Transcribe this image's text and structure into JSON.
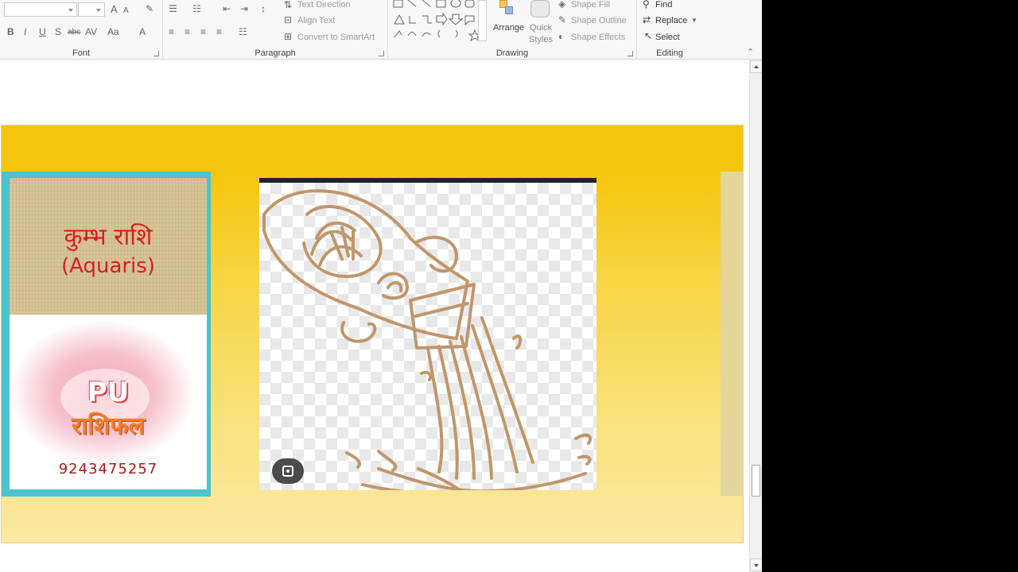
{
  "ribbon": {
    "font": {
      "label": "Font",
      "bold": "B",
      "italic": "I",
      "underline": "U",
      "strike": "S",
      "charspacing": "abc",
      "case": "Aa",
      "fontcolor": "A",
      "grow": "A",
      "shrink": "A"
    },
    "paragraph": {
      "label": "Paragraph",
      "text_direction": "Text Direction",
      "align_text": "Align Text",
      "convert_smartart": "Convert to SmartArt"
    },
    "drawing": {
      "label": "Drawing",
      "arrange": "Arrange",
      "quick_styles_1": "Quick",
      "quick_styles_2": "Styles",
      "shape_fill": "Shape Fill",
      "shape_outline": "Shape Outline",
      "shape_effects": "Shape Effects"
    },
    "editing": {
      "label": "Editing",
      "find": "Find",
      "replace": "Replace",
      "select": "Select"
    }
  },
  "slide": {
    "card": {
      "title_hindi": "कुम्भ राशि",
      "title_english": "(Aquaris)",
      "logo_pu": "PU",
      "logo_rashifal": "राशिफल",
      "phone": "9243475257"
    }
  },
  "colors": {
    "slide_top": "#f5c50d",
    "card_border": "#4cc2cc",
    "title_red": "#d62020",
    "drawing_brown": "#c0966a"
  }
}
